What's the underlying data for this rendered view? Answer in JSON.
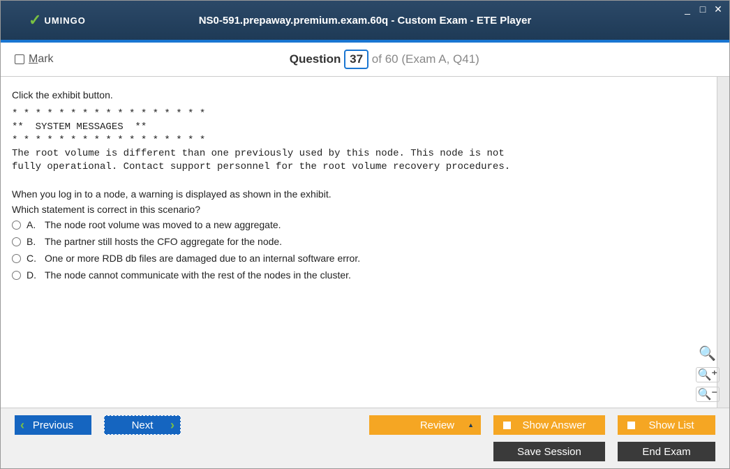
{
  "window": {
    "title": "NS0-591.prepaway.premium.exam.60q - Custom Exam - ETE Player",
    "logo_text": "UMINGO"
  },
  "question_bar": {
    "mark_label_m": "M",
    "mark_label_rest": "ark",
    "q_label": "Question",
    "current": "37",
    "total_text": "of 60 (Exam A, Q41)"
  },
  "content": {
    "intro": "Click the exhibit button.",
    "exhibit_line1": "* * * * * * * * * * * * * * * * *",
    "exhibit_line2": "**  SYSTEM MESSAGES  **",
    "exhibit_line3": "* * * * * * * * * * * * * * * * *",
    "exhibit_msg1": "The root volume is different than one previously used by this node. This node is not",
    "exhibit_msg2": "fully operational. Contact support personnel for the root volume recovery procedures.",
    "scenario": "When you log in to a node, a warning is displayed as shown in the exhibit.",
    "question": "Which statement is correct in this scenario?",
    "answers": [
      {
        "letter": "A.",
        "text": "The node root volume was moved to a new aggregate."
      },
      {
        "letter": "B.",
        "text": "The partner still hosts the CFO aggregate for the node."
      },
      {
        "letter": "C.",
        "text": "One or more RDB db files are damaged due to an internal software error."
      },
      {
        "letter": "D.",
        "text": "The node cannot communicate with the rest of the nodes in the cluster."
      }
    ]
  },
  "footer": {
    "previous": "Previous",
    "next": "Next",
    "review": "Review",
    "show_answer": "Show Answer",
    "show_list": "Show List",
    "save_session": "Save Session",
    "end_exam": "End Exam"
  }
}
